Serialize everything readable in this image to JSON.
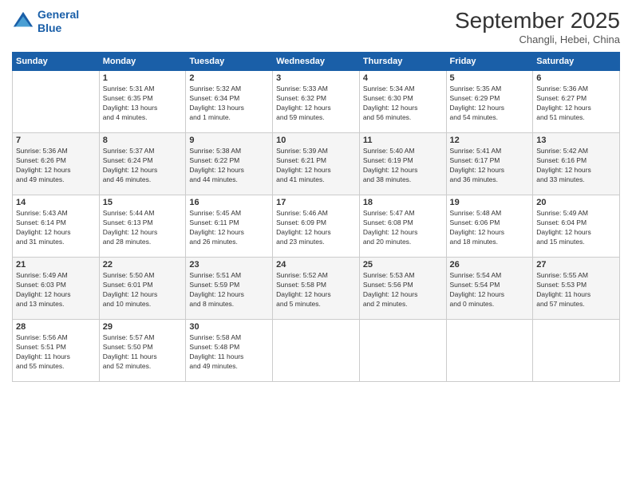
{
  "header": {
    "logo_line1": "General",
    "logo_line2": "Blue",
    "month": "September 2025",
    "location": "Changli, Hebei, China"
  },
  "days_of_week": [
    "Sunday",
    "Monday",
    "Tuesday",
    "Wednesday",
    "Thursday",
    "Friday",
    "Saturday"
  ],
  "weeks": [
    [
      {
        "day": "",
        "content": ""
      },
      {
        "day": "1",
        "content": "Sunrise: 5:31 AM\nSunset: 6:35 PM\nDaylight: 13 hours\nand 4 minutes."
      },
      {
        "day": "2",
        "content": "Sunrise: 5:32 AM\nSunset: 6:34 PM\nDaylight: 13 hours\nand 1 minute."
      },
      {
        "day": "3",
        "content": "Sunrise: 5:33 AM\nSunset: 6:32 PM\nDaylight: 12 hours\nand 59 minutes."
      },
      {
        "day": "4",
        "content": "Sunrise: 5:34 AM\nSunset: 6:30 PM\nDaylight: 12 hours\nand 56 minutes."
      },
      {
        "day": "5",
        "content": "Sunrise: 5:35 AM\nSunset: 6:29 PM\nDaylight: 12 hours\nand 54 minutes."
      },
      {
        "day": "6",
        "content": "Sunrise: 5:36 AM\nSunset: 6:27 PM\nDaylight: 12 hours\nand 51 minutes."
      }
    ],
    [
      {
        "day": "7",
        "content": "Sunrise: 5:36 AM\nSunset: 6:26 PM\nDaylight: 12 hours\nand 49 minutes."
      },
      {
        "day": "8",
        "content": "Sunrise: 5:37 AM\nSunset: 6:24 PM\nDaylight: 12 hours\nand 46 minutes."
      },
      {
        "day": "9",
        "content": "Sunrise: 5:38 AM\nSunset: 6:22 PM\nDaylight: 12 hours\nand 44 minutes."
      },
      {
        "day": "10",
        "content": "Sunrise: 5:39 AM\nSunset: 6:21 PM\nDaylight: 12 hours\nand 41 minutes."
      },
      {
        "day": "11",
        "content": "Sunrise: 5:40 AM\nSunset: 6:19 PM\nDaylight: 12 hours\nand 38 minutes."
      },
      {
        "day": "12",
        "content": "Sunrise: 5:41 AM\nSunset: 6:17 PM\nDaylight: 12 hours\nand 36 minutes."
      },
      {
        "day": "13",
        "content": "Sunrise: 5:42 AM\nSunset: 6:16 PM\nDaylight: 12 hours\nand 33 minutes."
      }
    ],
    [
      {
        "day": "14",
        "content": "Sunrise: 5:43 AM\nSunset: 6:14 PM\nDaylight: 12 hours\nand 31 minutes."
      },
      {
        "day": "15",
        "content": "Sunrise: 5:44 AM\nSunset: 6:13 PM\nDaylight: 12 hours\nand 28 minutes."
      },
      {
        "day": "16",
        "content": "Sunrise: 5:45 AM\nSunset: 6:11 PM\nDaylight: 12 hours\nand 26 minutes."
      },
      {
        "day": "17",
        "content": "Sunrise: 5:46 AM\nSunset: 6:09 PM\nDaylight: 12 hours\nand 23 minutes."
      },
      {
        "day": "18",
        "content": "Sunrise: 5:47 AM\nSunset: 6:08 PM\nDaylight: 12 hours\nand 20 minutes."
      },
      {
        "day": "19",
        "content": "Sunrise: 5:48 AM\nSunset: 6:06 PM\nDaylight: 12 hours\nand 18 minutes."
      },
      {
        "day": "20",
        "content": "Sunrise: 5:49 AM\nSunset: 6:04 PM\nDaylight: 12 hours\nand 15 minutes."
      }
    ],
    [
      {
        "day": "21",
        "content": "Sunrise: 5:49 AM\nSunset: 6:03 PM\nDaylight: 12 hours\nand 13 minutes."
      },
      {
        "day": "22",
        "content": "Sunrise: 5:50 AM\nSunset: 6:01 PM\nDaylight: 12 hours\nand 10 minutes."
      },
      {
        "day": "23",
        "content": "Sunrise: 5:51 AM\nSunset: 5:59 PM\nDaylight: 12 hours\nand 8 minutes."
      },
      {
        "day": "24",
        "content": "Sunrise: 5:52 AM\nSunset: 5:58 PM\nDaylight: 12 hours\nand 5 minutes."
      },
      {
        "day": "25",
        "content": "Sunrise: 5:53 AM\nSunset: 5:56 PM\nDaylight: 12 hours\nand 2 minutes."
      },
      {
        "day": "26",
        "content": "Sunrise: 5:54 AM\nSunset: 5:54 PM\nDaylight: 12 hours\nand 0 minutes."
      },
      {
        "day": "27",
        "content": "Sunrise: 5:55 AM\nSunset: 5:53 PM\nDaylight: 11 hours\nand 57 minutes."
      }
    ],
    [
      {
        "day": "28",
        "content": "Sunrise: 5:56 AM\nSunset: 5:51 PM\nDaylight: 11 hours\nand 55 minutes."
      },
      {
        "day": "29",
        "content": "Sunrise: 5:57 AM\nSunset: 5:50 PM\nDaylight: 11 hours\nand 52 minutes."
      },
      {
        "day": "30",
        "content": "Sunrise: 5:58 AM\nSunset: 5:48 PM\nDaylight: 11 hours\nand 49 minutes."
      },
      {
        "day": "",
        "content": ""
      },
      {
        "day": "",
        "content": ""
      },
      {
        "day": "",
        "content": ""
      },
      {
        "day": "",
        "content": ""
      }
    ]
  ]
}
